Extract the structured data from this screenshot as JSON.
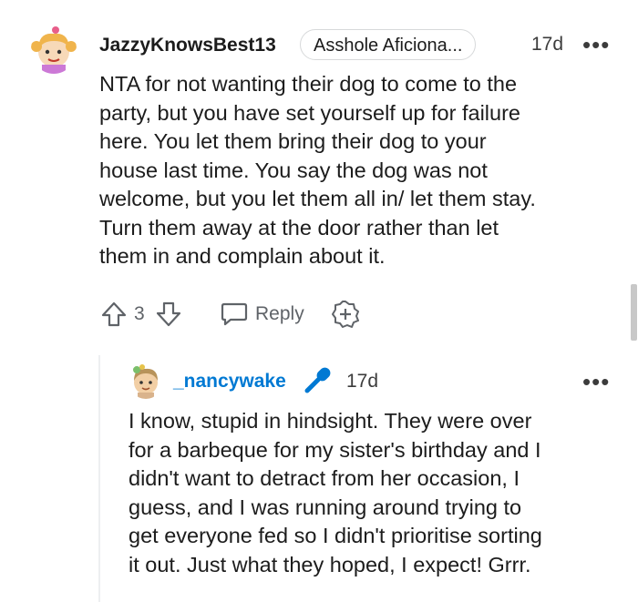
{
  "comment": {
    "username": "JazzyKnowsBest13",
    "flair": "Asshole Aficiona...",
    "time": "17d",
    "more_icon": "more-dots-icon",
    "body_lines": [
      "NTA for not wanting their dog to come to the",
      "party, but you have set yourself up for failure",
      "here. You let them bring their dog to your",
      "house last time. You say the dog was not",
      "welcome, but you let them all in/ let them stay.",
      "Turn them away at the door rather than let",
      "them in and complain about it."
    ],
    "votes": "3",
    "reply_label": "Reply"
  },
  "reply": {
    "username": "_nancywake",
    "badge_icon": "microphone-icon",
    "time": "17d",
    "body_lines": [
      "I know, stupid in hindsight. They were over",
      "for a barbeque for my sister's birthday and I",
      "didn't want to detract from her occasion, I",
      "guess, and I was running around trying to",
      "get everyone fed so I didn't prioritise sorting",
      "it out. Just what they hoped, I expect! Grrr."
    ]
  },
  "colors": {
    "op_accent": "#0079d3",
    "reply_username": "#0079d3",
    "text": "#1c1c1c",
    "muted": "#5f6368"
  }
}
